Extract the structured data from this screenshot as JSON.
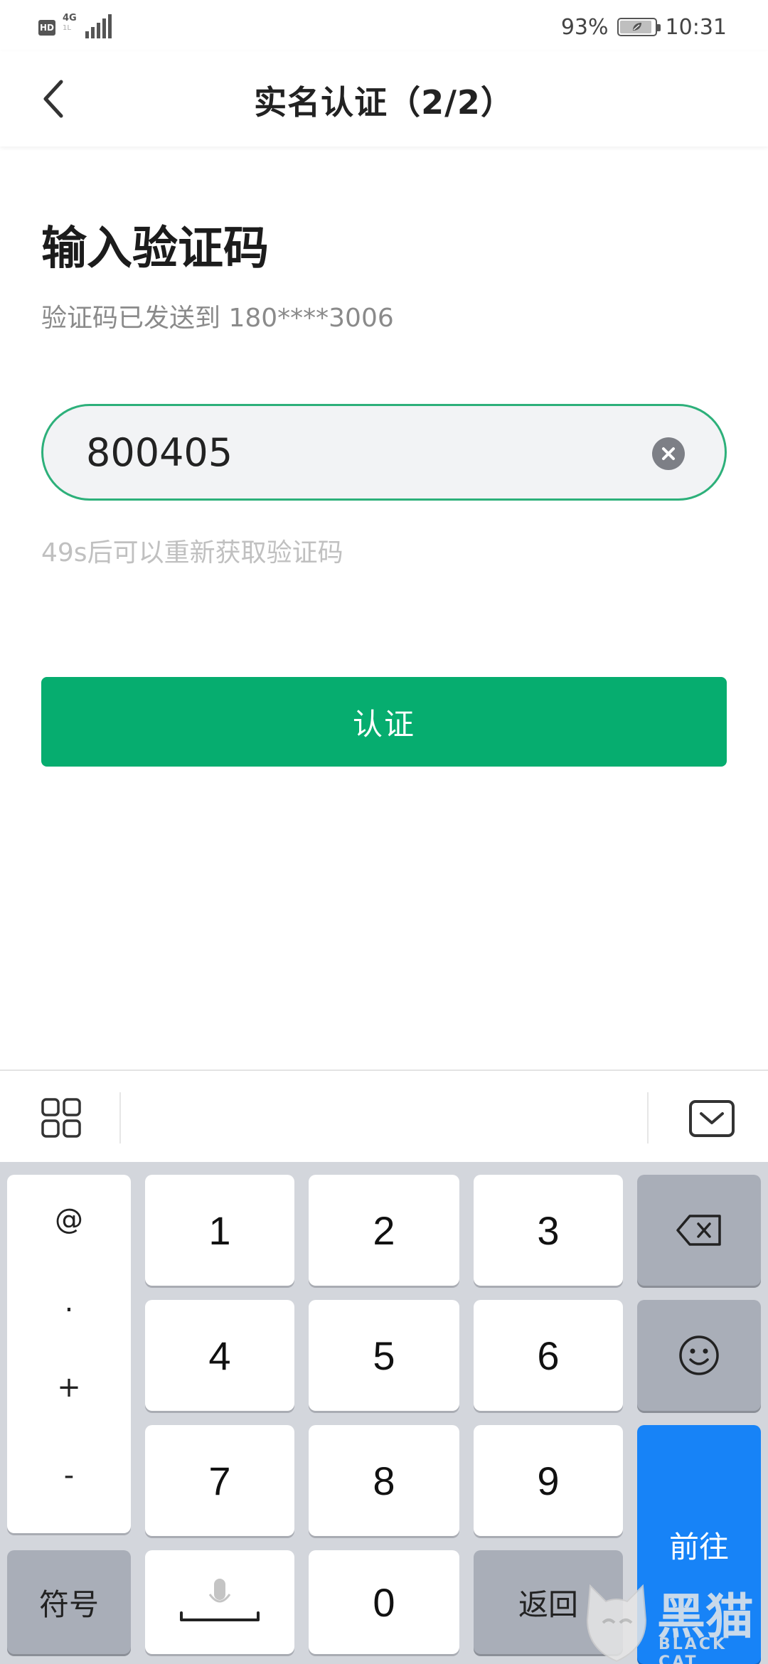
{
  "status_bar": {
    "hd": "HD",
    "network": "4G",
    "network_sub": "1L",
    "battery_percent": "93%",
    "time": "10:31",
    "battery_level": 0.93
  },
  "nav": {
    "title": "实名认证（2/2）",
    "back_icon": "chevron-left-icon"
  },
  "content": {
    "heading": "输入验证码",
    "sent_to": "验证码已发送到 180****3006",
    "code_value": "800405",
    "resend_hint": "49s后可以重新获取验证码",
    "submit_label": "认证"
  },
  "keyboard_toolbar": {
    "grid_icon": "grid-icon",
    "hide_icon": "keyboard-hide-icon"
  },
  "keyboard": {
    "symbols": [
      "@",
      ".",
      "+",
      "-"
    ],
    "digits": [
      "1",
      "2",
      "3",
      "4",
      "5",
      "6",
      "7",
      "8",
      "9",
      "0"
    ],
    "symbol_switch": "符号",
    "back": "返回",
    "go": "前往",
    "backspace_icon": "backspace-icon",
    "emoji_icon": "emoji-icon",
    "mic_icon": "microphone-icon"
  },
  "watermark": {
    "text": "黑猫",
    "sub": "BLACK CAT"
  },
  "colors": {
    "accent": "#06ad6f",
    "input_border": "#2db07a",
    "go_key": "#1783f7"
  }
}
